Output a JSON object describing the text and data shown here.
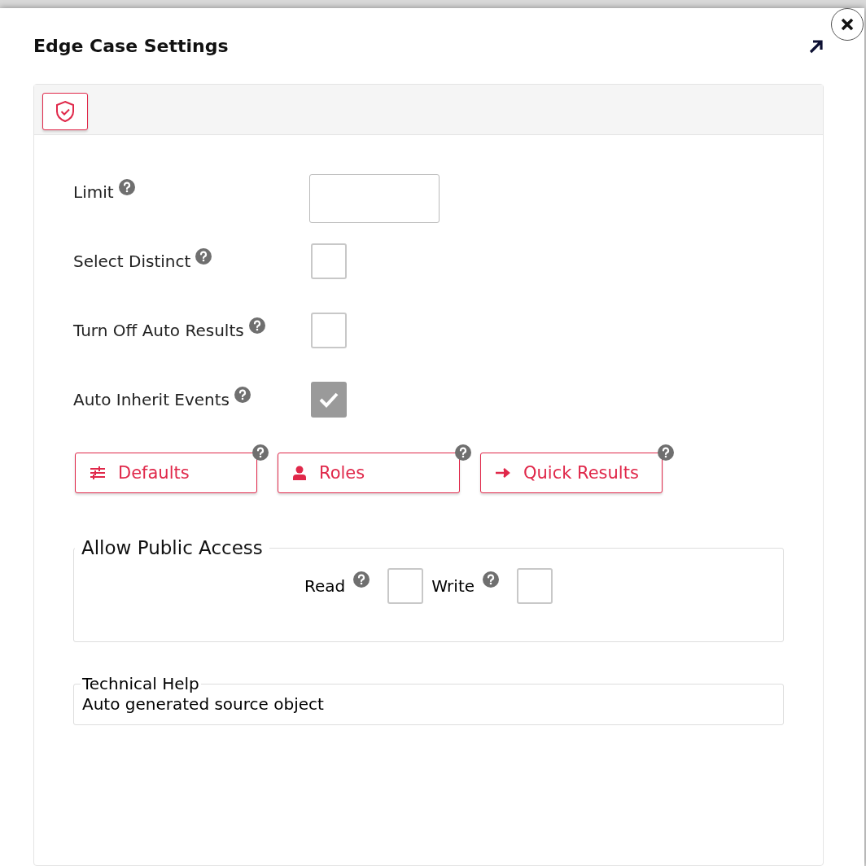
{
  "dialog": {
    "title": "Edge Case Settings"
  },
  "fields": [
    {
      "kind": "text",
      "label": "Limit"
    },
    {
      "kind": "checkbox",
      "label": "Select Distinct",
      "checked": false
    },
    {
      "kind": "checkbox",
      "label": "Turn Off Auto Results",
      "checked": false
    },
    {
      "kind": "checkbox",
      "label": "Auto Inherit Events",
      "checked": true
    }
  ],
  "buttons": [
    {
      "label": "Defaults"
    },
    {
      "label": "Roles"
    },
    {
      "label": "Quick Results"
    }
  ],
  "public_access": {
    "legend": "Allow Public Access",
    "options": [
      {
        "label": "Read",
        "checked": false
      },
      {
        "label": "Write",
        "checked": false
      }
    ]
  },
  "technical_help": {
    "legend": "Technical Help",
    "text": "Auto generated source object"
  }
}
